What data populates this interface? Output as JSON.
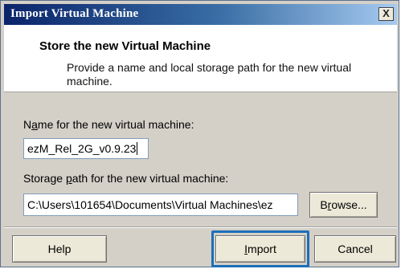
{
  "window": {
    "title": "Import Virtual Machine",
    "close_label": "X"
  },
  "header": {
    "title": "Store the new Virtual Machine",
    "description": "Provide a name and local storage path for the new virtual machine."
  },
  "name_field": {
    "label_prefix": "N",
    "label_accesskey": "a",
    "label_suffix": "me for the new virtual machine:",
    "value": "ezM_Rel_2G_v0.9.23"
  },
  "path_field": {
    "label_prefix": "Storage ",
    "label_accesskey": "p",
    "label_suffix": "ath for the new virtual machine:",
    "value": "C:\\Users\\101654\\Documents\\Virtual Machines\\ez"
  },
  "buttons": {
    "browse": {
      "prefix": "B",
      "accesskey": "r",
      "suffix": "owse..."
    },
    "help": "Help",
    "import": {
      "accesskey": "I",
      "suffix": "mport"
    },
    "cancel": "Cancel"
  },
  "colors": {
    "title_bar_start": "#0a246a",
    "title_bar_end": "#a6caf0",
    "highlight_box": "#1d6fb8",
    "dialog_background": "#d4d0c8"
  }
}
